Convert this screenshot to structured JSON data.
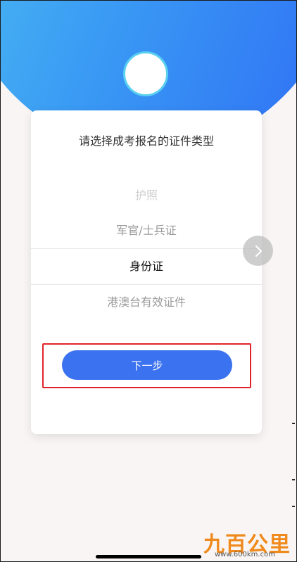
{
  "card": {
    "title": "请选择成考报名的证件类型",
    "options": [
      {
        "label": "护照",
        "state": "faint"
      },
      {
        "label": "军官/士兵证",
        "state": "mid"
      },
      {
        "label": "身份证",
        "state": "selected"
      },
      {
        "label": "港澳台有效证件",
        "state": "mid"
      }
    ],
    "next_label": "下一步"
  },
  "icons": {
    "side_arrow": "chevron-right-icon"
  },
  "colors": {
    "hero_start": "#4fc1f0",
    "hero_end": "#2f6ef5",
    "primary_button": "#3b72f0",
    "highlight_box": "#e2222a",
    "watermark": "#f08a1d"
  },
  "watermark": {
    "brand": "九百公里",
    "url": "www.600km.com"
  }
}
